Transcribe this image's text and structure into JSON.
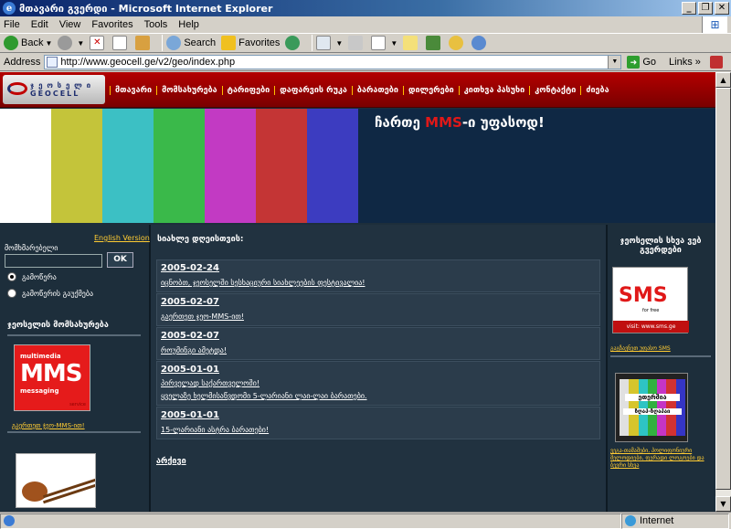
{
  "window": {
    "title": "მთავარი გვერდი - Microsoft Internet Explorer",
    "buttons": [
      "_",
      "❐",
      "✕"
    ]
  },
  "menubar": [
    "File",
    "Edit",
    "View",
    "Favorites",
    "Tools",
    "Help"
  ],
  "toolbar": {
    "back": "Back",
    "search": "Search",
    "favorites": "Favorites"
  },
  "address": {
    "label": "Address",
    "url": "http://www.geocell.ge/v2/geo/index.php",
    "go": "Go",
    "links": "Links"
  },
  "site": {
    "logo_top": "ჯ ე ო ს ე ლ ი",
    "logo_bottom": "GEOCELL",
    "nav": [
      "მთავარი",
      "მომსახურება",
      "ტარიფები",
      "დაფარვის რუკა",
      "ბარათები",
      "დილერები",
      "კითხვა პასუხი",
      "კონტაქტი",
      "ძიება"
    ],
    "banner_pre": "ჩართე ",
    "banner_mms": "MMS",
    "banner_post": "-ი უფასოდ!",
    "banner_bar_colors": [
      "#ffffff",
      "#c4c43a",
      "#3cc0c4",
      "#3ab94a",
      "#c23ac3",
      "#c43535",
      "#3c3cc0"
    ],
    "english_version": "English Version",
    "user_label": "მომხმარებელი",
    "ok": "OK",
    "radio1": "გამოწერა",
    "radio2": "გამოწერის გაუქმება",
    "services_heading": "ჯეოსელის მომსახურება",
    "mms_img": {
      "l1": "multimedia",
      "l2": "MMS",
      "l3": "messaging",
      "l4": "service"
    },
    "mms_link": "გაერთეთ ჯეო-MMS-ით!",
    "news_heading": "სიახლე დღეისთვის:",
    "news": [
      {
        "date": "2005-02-24",
        "lines": [
          "იცნობთ, ჯეოსელში სესხაციური სიახლეების ფესტივალია!"
        ]
      },
      {
        "date": "2005-02-07",
        "lines": [
          "გაერთეთ ჯეო-MMS-ით!"
        ]
      },
      {
        "date": "2005-02-07",
        "lines": [
          "როუმინგი ამეტდა!"
        ]
      },
      {
        "date": "2005-01-01",
        "lines": [
          "პირველად საქართველოში!",
          "ყველაზე ხელმისაწვდომი 5-ლარიანი ლაი-ლაი ბარათები."
        ]
      },
      {
        "date": "2005-01-01",
        "lines": [
          "15-ლარიანი ასტრა ბარათები!"
        ]
      }
    ],
    "archive": "არქივი",
    "right_heading": "ჯეოსელის სხვა ვებ გვერდები",
    "sms_img": {
      "big": "SMS",
      "small": "for free",
      "url": "visit: www.sms.ge"
    },
    "sms_link": "გაგზავნეთ უფასო SMS",
    "tv_img": {
      "l1": "ეთერშია",
      "l2": "ზღაპ-ზღაპაი"
    },
    "tv_bar_colors": [
      "#e0e0e0",
      "#d6c52c",
      "#2ec4c4",
      "#32b040",
      "#c535c5",
      "#d23232",
      "#3535c5"
    ],
    "tv_link": "ვეგა-თამაშები, პოლიფონიური მელოდიები, ფერადი ლოგოები და ბევრი სხვა"
  },
  "statusbar": {
    "zone": "Internet"
  }
}
